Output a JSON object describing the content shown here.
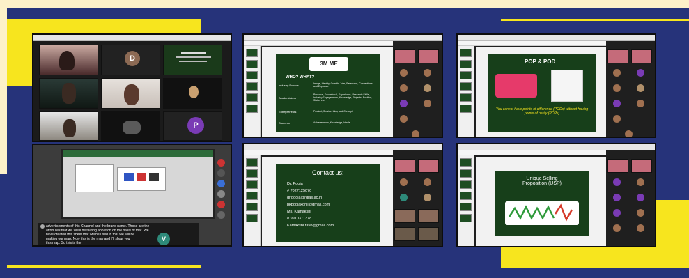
{
  "panel1": {
    "tiles": [
      {
        "name": ""
      },
      {
        "name": "D"
      },
      {
        "name": ""
      },
      {
        "name": ""
      },
      {
        "name": ""
      },
      {
        "name": ""
      },
      {
        "name": ""
      },
      {
        "name": ""
      },
      {
        "name": "P"
      }
    ],
    "avatar_d": "D",
    "avatar_p": "P"
  },
  "panel2": {
    "caption_lines": [
      "advertisements of this Channel and the brand name. Those are the",
      "attributes that we We'll be talking about on on the basis of that. We",
      "have created this sheet that will be used in that we will be",
      "making our map. Now this is the map and I'll show you",
      "this map. So this is the"
    ],
    "avatar_v": "V"
  },
  "panel3": {
    "title": "WHO? WHAT?",
    "rows": [
      {
        "label": "Industry Experts",
        "value": "Image, Identity, Growth, Jobs, Reference, Connections, and Exposure"
      },
      {
        "label": "Academicians",
        "value": "Personal, Educational, Experience, Research Skills, Industry Engagements, Knowledge, Projects, Position, Status etc."
      },
      {
        "label": "Entrepreneurs",
        "value": "Product, Service, Idea, and Concept"
      },
      {
        "label": "Students",
        "value": "Achievements, Knowledge, Ideals"
      }
    ],
    "logo_text": "3M ME"
  },
  "panel4": {
    "title": "POP & POD",
    "caption": "You cannot have points of difference (PODs) without having points of parity (POPs)"
  },
  "panel5": {
    "title": "Contact us:",
    "lines": [
      "Dr. Pooja",
      "# 7027125070",
      "dr.pooja@rdias.ac.in",
      "pkpoojakohli@gmail.com",
      "Ms. Kamakshi",
      "# 9910371378",
      "Kamakshi.ravo@gmail.com"
    ]
  },
  "panel6": {
    "title": "Unique Selling Proposition (USP)"
  },
  "colors": {
    "background": "#26337a",
    "yellow": "#f7e51e",
    "cream": "#fdf1c9",
    "slide_green": "#173f1a"
  }
}
